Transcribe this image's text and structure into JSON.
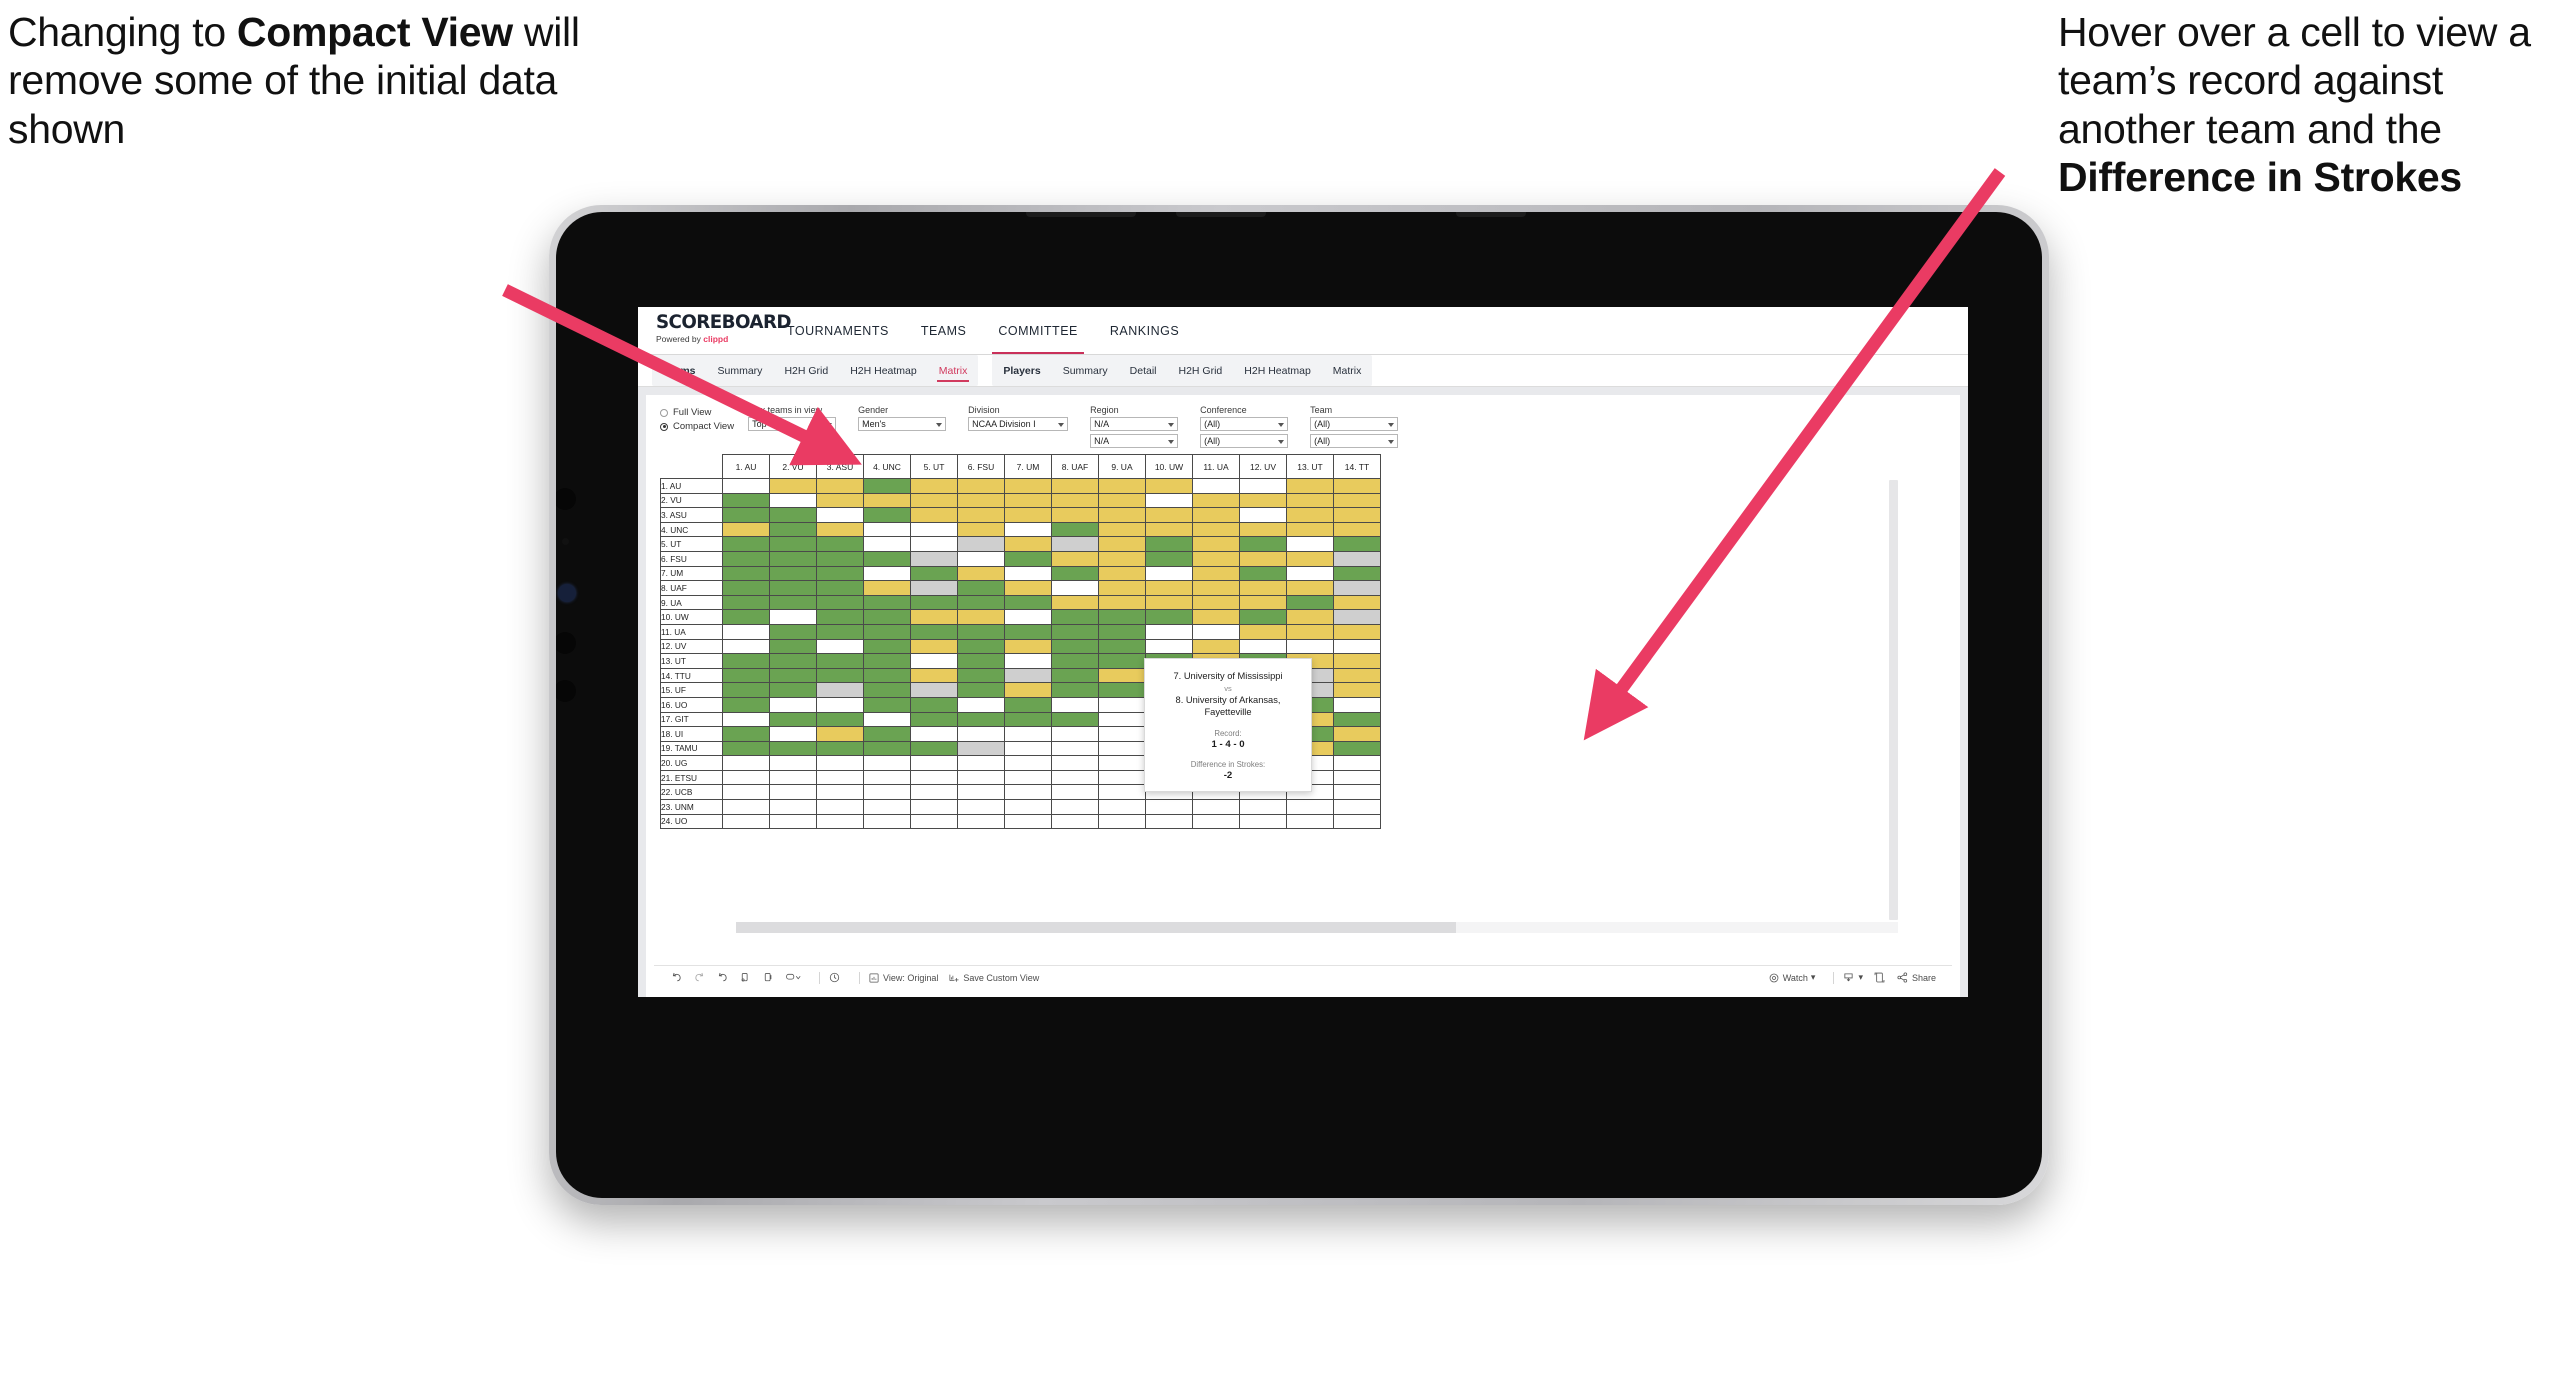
{
  "annotations": {
    "left": {
      "part1": "Changing to ",
      "bold": "Compact View",
      "part2": " will remove some of the initial data shown"
    },
    "right": {
      "part1": "Hover over a cell to view a team’s record against another team and the ",
      "bold": "Difference in Strokes",
      "part2": ""
    },
    "arrow_color": "#ea3b63"
  },
  "app": {
    "logo": {
      "word": "SCOREBOARD",
      "powered_prefix": "Powered by ",
      "brand": "clippd"
    },
    "topnav": [
      {
        "label": "TOURNAMENTS",
        "active": false
      },
      {
        "label": "TEAMS",
        "active": false
      },
      {
        "label": "COMMITTEE",
        "active": true
      },
      {
        "label": "RANKINGS",
        "active": false
      }
    ],
    "subnav": [
      {
        "head": "Teams",
        "items": [
          {
            "label": "Summary",
            "active": false
          },
          {
            "label": "H2H Grid",
            "active": false
          },
          {
            "label": "H2H Heatmap",
            "active": false
          },
          {
            "label": "Matrix",
            "active": true
          }
        ]
      },
      {
        "head": "Players",
        "items": [
          {
            "label": "Summary",
            "active": false
          },
          {
            "label": "Detail",
            "active": false
          },
          {
            "label": "H2H Grid",
            "active": false
          },
          {
            "label": "H2H Heatmap",
            "active": false
          },
          {
            "label": "Matrix",
            "active": false
          }
        ]
      }
    ]
  },
  "filters": {
    "view_mode": {
      "options": [
        "Full View",
        "Compact View"
      ],
      "selected": "Compact View"
    },
    "max_teams": {
      "label": "Max teams in view",
      "value": "Top 50"
    },
    "gender": {
      "label": "Gender",
      "value": "Men's"
    },
    "division": {
      "label": "Division",
      "value": "NCAA Division I"
    },
    "region": {
      "label": "Region",
      "value1": "N/A",
      "value2": "N/A"
    },
    "conference": {
      "label": "Conference",
      "value1": "(All)",
      "value2": "(All)"
    },
    "team": {
      "label": "Team",
      "value1": "(All)",
      "value2": "(All)"
    }
  },
  "matrix": {
    "columns": [
      "1. AU",
      "2. VU",
      "3. ASU",
      "4. UNC",
      "5. UT",
      "6. FSU",
      "7. UM",
      "8. UAF",
      "9. UA",
      "10. UW",
      "11. UA",
      "12. UV",
      "13. UT",
      "14. TT"
    ],
    "rows": [
      "1. AU",
      "2. VU",
      "3. ASU",
      "4. UNC",
      "5. UT",
      "6. FSU",
      "7. UM",
      "8. UAF",
      "9. UA",
      "10. UW",
      "11. UA",
      "12. UV",
      "13. UT",
      "14. TTU",
      "15. UF",
      "16. UO",
      "17. GIT",
      "18. UI",
      "19. TAMU",
      "20. UG",
      "21. ETSU",
      "22. UCB",
      "23. UNM",
      "24. UO"
    ],
    "legend_colors": {
      "win": "#6aa352",
      "loss": "#e8cb5d",
      "tie": "#cfcfcf",
      "none": "#ffffff"
    },
    "cells": [
      [
        "w",
        "y",
        "y",
        "g",
        "y",
        "y",
        "y",
        "y",
        "y",
        "y",
        "w",
        "w",
        "y",
        "y"
      ],
      [
        "g",
        "w",
        "y",
        "y",
        "y",
        "y",
        "y",
        "y",
        "y",
        "w",
        "y",
        "y",
        "y",
        "y"
      ],
      [
        "g",
        "g",
        "w",
        "g",
        "y",
        "y",
        "y",
        "y",
        "y",
        "y",
        "y",
        "w",
        "y",
        "y"
      ],
      [
        "y",
        "g",
        "y",
        "w",
        "w",
        "y",
        "w",
        "g",
        "y",
        "y",
        "y",
        "y",
        "y",
        "y"
      ],
      [
        "g",
        "g",
        "g",
        "w",
        "w",
        "x",
        "y",
        "x",
        "y",
        "g",
        "y",
        "g",
        "w",
        "g"
      ],
      [
        "g",
        "g",
        "g",
        "g",
        "x",
        "w",
        "g",
        "y",
        "y",
        "g",
        "y",
        "y",
        "y",
        "x"
      ],
      [
        "g",
        "g",
        "g",
        "w",
        "g",
        "y",
        "w",
        "g",
        "y",
        "w",
        "y",
        "g",
        "w",
        "g"
      ],
      [
        "g",
        "g",
        "g",
        "y",
        "x",
        "g",
        "y",
        "w",
        "y",
        "y",
        "y",
        "y",
        "y",
        "x"
      ],
      [
        "g",
        "g",
        "g",
        "g",
        "g",
        "g",
        "g",
        "y",
        "y",
        "y",
        "y",
        "y",
        "g",
        "y"
      ],
      [
        "g",
        "w",
        "g",
        "g",
        "y",
        "y",
        "w",
        "g",
        "g",
        "g",
        "y",
        "g",
        "y",
        "x"
      ],
      [
        "w",
        "g",
        "g",
        "g",
        "g",
        "g",
        "g",
        "g",
        "g",
        "w",
        "w",
        "y",
        "y",
        "y"
      ],
      [
        "w",
        "g",
        "w",
        "g",
        "y",
        "g",
        "y",
        "g",
        "g",
        "w",
        "y",
        "w",
        "w",
        "w"
      ],
      [
        "g",
        "g",
        "g",
        "g",
        "w",
        "g",
        "w",
        "g",
        "g",
        "g",
        "y",
        "g",
        "y",
        "y"
      ],
      [
        "g",
        "g",
        "g",
        "g",
        "y",
        "g",
        "x",
        "g",
        "y",
        "g",
        "g",
        "g",
        "x",
        "y"
      ],
      [
        "g",
        "g",
        "x",
        "g",
        "x",
        "g",
        "y",
        "g",
        "g",
        "w",
        "w",
        "g",
        "x",
        "y"
      ],
      [
        "g",
        "w",
        "w",
        "g",
        "g",
        "w",
        "g",
        "w",
        "w",
        "y",
        "w",
        "g",
        "g",
        "w"
      ],
      [
        "w",
        "g",
        "g",
        "w",
        "g",
        "g",
        "g",
        "g",
        "w",
        "g",
        "y",
        "w",
        "y",
        "g"
      ],
      [
        "g",
        "w",
        "y",
        "g",
        "w",
        "w",
        "w",
        "w",
        "w",
        "y",
        "g",
        "w",
        "g",
        "y"
      ],
      [
        "g",
        "g",
        "g",
        "g",
        "g",
        "x",
        "w",
        "w",
        "w",
        "g",
        "y",
        "w",
        "y",
        "g"
      ],
      [
        "w",
        "w",
        "w",
        "w",
        "w",
        "w",
        "w",
        "w",
        "w",
        "w",
        "w",
        "w",
        "w",
        "w"
      ],
      [
        "w",
        "w",
        "w",
        "w",
        "w",
        "w",
        "w",
        "w",
        "w",
        "w",
        "w",
        "w",
        "w",
        "w"
      ],
      [
        "w",
        "w",
        "w",
        "w",
        "w",
        "w",
        "w",
        "w",
        "w",
        "w",
        "w",
        "w",
        "w",
        "w"
      ],
      [
        "w",
        "w",
        "w",
        "w",
        "w",
        "w",
        "w",
        "w",
        "w",
        "w",
        "w",
        "w",
        "w",
        "w"
      ],
      [
        "w",
        "w",
        "w",
        "w",
        "w",
        "w",
        "w",
        "w",
        "w",
        "w",
        "w",
        "w",
        "w",
        "w"
      ]
    ]
  },
  "tooltip": {
    "team_a": "7. University of Mississippi",
    "vs": "vs",
    "team_b": "8. University of Arkansas, Fayetteville",
    "record_label": "Record:",
    "record_value": "1 - 4 - 0",
    "diff_label": "Difference in Strokes:",
    "diff_value": "-2"
  },
  "toolbar": {
    "view_original": "View: Original",
    "save_custom_view": "Save Custom View",
    "watch": "Watch",
    "share": "Share"
  }
}
